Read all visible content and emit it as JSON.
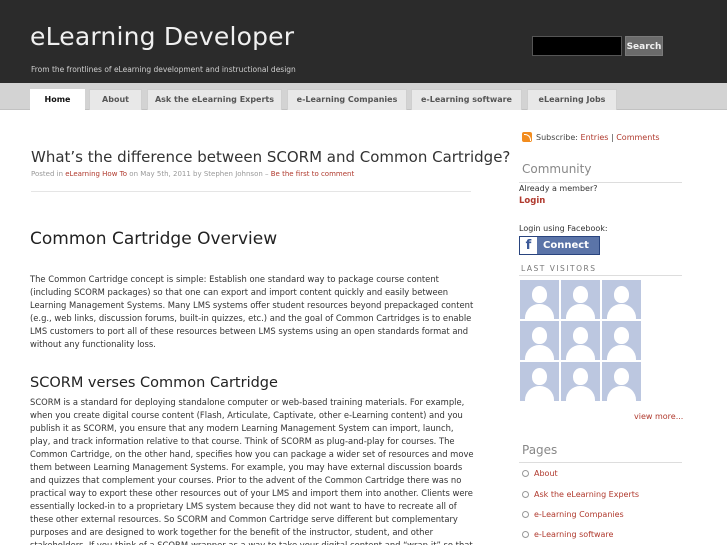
{
  "header": {
    "site_title": "eLearning Developer",
    "tagline": "From the frontlines of eLearning development and instructional design",
    "search_button": "Search",
    "search_value": ""
  },
  "nav": {
    "tabs": [
      {
        "label": "Home",
        "active": true
      },
      {
        "label": "About"
      },
      {
        "label": "Ask the eLearning Experts"
      },
      {
        "label": "e-Learning Companies"
      },
      {
        "label": "e-Learning software"
      },
      {
        "label": "eLearning Jobs"
      }
    ]
  },
  "post": {
    "title": "What’s the difference between SCORM and Common Cartridge?",
    "meta": {
      "posted_in": "Posted in",
      "category": "eLearning How To",
      "date_by": "on May 5th, 2011 by Stephen Johnson –",
      "comment_link": "Be the first to comment"
    },
    "heading1": "Common Cartridge Overview",
    "paragraph1": "The  Common Cartridge concept is simple: Establish one standard way to package course content (including SCORM packages) so that one can export and import content quickly and easily between Learning Management Systems. Many LMS systems offer student resources beyond prepackaged content (e.g., web links, discussion forums, built-in quizzes, etc.) and the goal of Common Cartridges is to enable LMS customers to port all of these resources between LMS systems using an open standards format and without any functionality loss.",
    "heading2": "SCORM verses Common Cartridge",
    "paragraph2": "SCORM is a standard for deploying standalone computer or web-based training materials. For example, when you create digital course content (Flash, Articulate, Captivate, other e-Learning content) and you publish it as SCORM, you ensure that any modern Learning Management System can import, launch, play, and track information relative to that course. Think of SCORM as plug-and-play for courses. The Common Cartridge, on the other hand, specifies how you can package a wider set of resources and move them between Learning Management Systems. For example, you may have external discussion boards and quizzes that complement your courses. Prior to the advent of the Common Cartridge there was no practical way to export these other resources out of your LMS and import them into another. Clients were essentially locked-in to a proprietary LMS system because they did not want to have to recreate all of these other external resources. So SCORM and Common Cartridge serve different but complementary purposes and are designed to work together for the benefit of the instructor, student, and other stakeholders. If you think of a SCORM-wrapper as a way to take your digital content and “wrap-it” so that it can communicate with an"
  },
  "sidebar": {
    "subscribe_label": "Subscribe:",
    "entries_link": "Entries",
    "separator": "|",
    "comments_link": "Comments",
    "community_heading": "Community",
    "already_member": "Already a member?",
    "login": "Login",
    "fb_label": "Login using Facebook:",
    "fb_f": "f",
    "fb_connect": "Connect",
    "last_visitors": "LAST VISITORS",
    "visitor_count": 9,
    "view_more": "view more...",
    "pages_heading": "Pages",
    "pages": [
      "About",
      "Ask the eLearning Experts",
      "e-Learning Companies",
      "e-Learning software"
    ]
  },
  "colors": {
    "header_bg": "#2b2b2b",
    "nav_bg": "#d3d3d3",
    "link": "#b03a2e",
    "facebook": "#5b74a8"
  }
}
